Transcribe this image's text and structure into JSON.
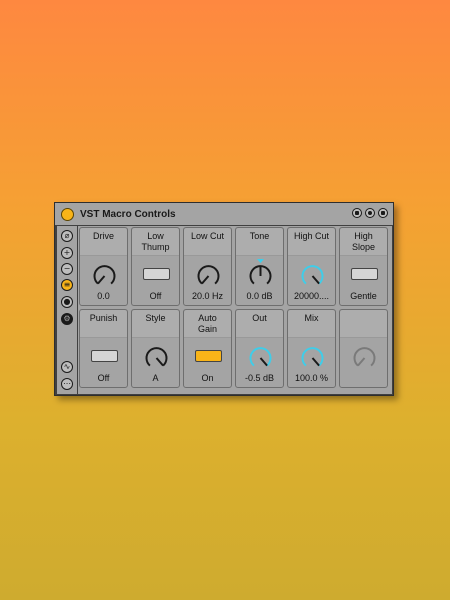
{
  "device": {
    "title": "VST Macro Controls",
    "header_icons": [
      "save-preset-icon",
      "hot-swap-icon",
      "save-icon"
    ]
  },
  "sidebar": {
    "icons": [
      "pin-icon",
      "add-icon",
      "remove-icon",
      "macro-list-icon",
      "record-icon",
      "settings-icon",
      "randomize-icon",
      "more-icon"
    ]
  },
  "colors": {
    "accent": "#f9b418",
    "knob_highlight": "#3fcde9",
    "panel": "#a4a4a4"
  },
  "controls": {
    "drive": {
      "label": "Drive",
      "value": "0.0"
    },
    "low_thump": {
      "label": "Low\nThump",
      "value": "Off"
    },
    "low_cut": {
      "label": "Low Cut",
      "value": "20.0 Hz"
    },
    "tone": {
      "label": "Tone",
      "value": "0.0 dB"
    },
    "high_cut": {
      "label": "High Cut",
      "value": "20000...."
    },
    "high_slope": {
      "label": "High\nSlope",
      "value": "Gentle"
    },
    "punish": {
      "label": "Punish",
      "value": "Off"
    },
    "style": {
      "label": "Style",
      "value": "A"
    },
    "auto_gain": {
      "label": "Auto\nGain",
      "value": "On"
    },
    "out": {
      "label": "Out",
      "value": "-0.5 dB"
    },
    "mix": {
      "label": "Mix",
      "value": "100.0 %"
    },
    "empty": {
      "label": "",
      "value": ""
    }
  }
}
